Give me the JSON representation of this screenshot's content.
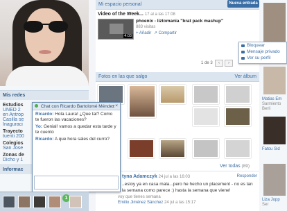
{
  "profile": {
    "recent_section": "Mis redes",
    "studies_label": "Estudios",
    "studies_lines": [
      "UNED 2",
      "en Antrop",
      "Casilla se",
      "Inaguraci"
    ],
    "trajectory_label": "Trayecto",
    "trajectory_value": "tuenti 200",
    "schools_label": "Colegios",
    "schools_value": "San Jose",
    "zones_label": "Zonas de",
    "zones_value": "Dicho y 1",
    "info_label": "Informac"
  },
  "main": {
    "personal_space": "Mi espacio personal",
    "new_entry_button": "Nueva entrada",
    "video_title": "Video of the Week...",
    "video_date": "17 al a las 17:08",
    "video_name": "phoenix - liztomania \"brat pack mashup\"",
    "video_views": "883 visitas",
    "video_duration": "4:03",
    "video_add": "Añadir",
    "video_share": "Compartir",
    "pager_text": "1 de 3",
    "photos_header": "Fotos en las que salgo",
    "my_album": "Ver álbum",
    "view_all": "Ver todas",
    "view_all_count": "(89)",
    "comment_author": "tyna Adamczyk",
    "comment_date": "24 jul a las 16:03",
    "comment_reply": "Responder",
    "comment_text_1": "..estoy ya en casa mala...pero he hecho un placement - no es tan",
    "comment_text_2": "la semana como parece :) hasta la semana que viene!",
    "comment2_prefix": "voy que tienes semana",
    "comment2_author": "Emilio Jiménez Sánchez",
    "comment2_date": "24 jul a las 15:17"
  },
  "dropdown": {
    "block": "Bloquear",
    "private_message": "Mensaje privado",
    "view_profile": "Ver su perfil"
  },
  "chat": {
    "title": "Chat con Ricardo Bartolomé Méndez",
    "messages": [
      {
        "from": "Ricardo:",
        "text": "Hola Laura! ¿Que tal? Como te fueron las vacaciones?"
      },
      {
        "from": "Yo:",
        "text": "Genial! vamos a quedar esta tarde y te cuento"
      },
      {
        "from": "Ricardo:",
        "text": "A que hora sales del curro?"
      }
    ],
    "input_placeholder": "",
    "badge_count": "1"
  },
  "right": {
    "name1": "Matias Em",
    "name1b": "Sarmiento",
    "name1c": "Berli",
    "name2": "Fatou Sid",
    "name3": "Liza Jopp",
    "name3b": "Ser"
  }
}
